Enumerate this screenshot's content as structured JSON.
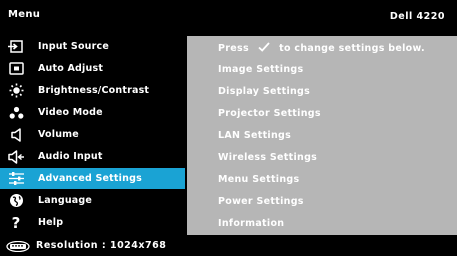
{
  "header": {
    "menu_title": "Menu",
    "model": "Dell 4220"
  },
  "menu": {
    "items": [
      {
        "label": "Input Source",
        "icon": "input-source-icon",
        "selected": false
      },
      {
        "label": "Auto Adjust",
        "icon": "auto-adjust-icon",
        "selected": false
      },
      {
        "label": "Brightness/Contrast",
        "icon": "brightness-icon",
        "selected": false
      },
      {
        "label": "Video Mode",
        "icon": "video-mode-icon",
        "selected": false
      },
      {
        "label": "Volume",
        "icon": "volume-icon",
        "selected": false
      },
      {
        "label": "Audio Input",
        "icon": "audio-input-icon",
        "selected": false
      },
      {
        "label": "Advanced Settings",
        "icon": "advanced-settings-icon",
        "selected": true
      },
      {
        "label": "Language",
        "icon": "language-icon",
        "selected": false
      },
      {
        "label": "Help",
        "icon": "help-icon",
        "selected": false
      }
    ]
  },
  "submenu": {
    "hint_prefix": "Press",
    "hint_icon": "checkmark-icon",
    "hint_suffix": "to change settings below.",
    "items": [
      "Image Settings",
      "Display Settings",
      "Projector Settings",
      "LAN Settings",
      "Wireless Settings",
      "Menu Settings",
      "Power Settings",
      "Information"
    ]
  },
  "status": {
    "icon": "resolution-icon",
    "text": "Resolution : 1024x768"
  },
  "colors": {
    "background": "#000000",
    "selected": "#1aa3d4",
    "panel": "#b6b6b6",
    "text": "#ffffff"
  }
}
